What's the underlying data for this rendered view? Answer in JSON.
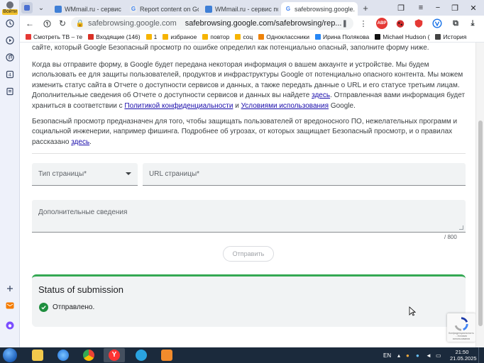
{
  "sidepanel": {
    "login_label": "Войти"
  },
  "tabs": [
    {
      "title": "",
      "icon": "yandex-icon"
    },
    {
      "title": "WMmail.ru - сервис по",
      "icon": "wmmail-icon"
    },
    {
      "title": "Report content on Goo",
      "icon": "google-icon"
    },
    {
      "title": "WMmail.ru - сервис по",
      "icon": "wmmail-icon"
    },
    {
      "title": "safebrowsing.google.",
      "icon": "google-icon"
    }
  ],
  "address": {
    "host": "safebrowsing.google.com",
    "url": "safebrowsing.google.com/safebrowsing/rep..."
  },
  "extensions": {
    "abp_label": "ABP"
  },
  "bookmarks": [
    {
      "label": "Смотреть ТВ – те",
      "color": "#e53935"
    },
    {
      "label": "Входящие (146)",
      "color": "#d93025"
    },
    {
      "label": "1",
      "color": "#f6b400"
    },
    {
      "label": "избраное",
      "color": "#f6b400"
    },
    {
      "label": "повтор",
      "color": "#f6b400"
    },
    {
      "label": "соц",
      "color": "#f6b400"
    },
    {
      "label": "Одноклассники",
      "color": "#ee8208"
    },
    {
      "label": "Ирина Полякова",
      "color": "#2787f5"
    },
    {
      "label": "Michael Hudson (",
      "color": "#111111"
    },
    {
      "label": "История",
      "color": "#444444"
    }
  ],
  "content": {
    "intro_tail": "сайте, который Google Безопасный просмотр по ошибке определил как потенциально опасный, заполните форму ниже.",
    "p2_a": "Когда вы отправите форму, в Google будет передана некоторая информация о вашем аккаунте и устройстве. Мы будем использовать ее для защиты пользователей, продуктов и инфраструктуры Google от потенциально опасного контента. Мы можем изменить статус сайта в Отчете о доступности сервисов и данных, а также передать данные о URL и его статусе третьим лицам. Дополнительные сведения об Отчете о доступности сервисов и данных вы найдете ",
    "p2_link1": "здесь",
    "p2_b": ". Отправленная вами информация будет храниться в соответствии с ",
    "p2_link2": "Политикой конфиденциальности",
    "p2_c": " и ",
    "p2_link3": "Условиями использования",
    "p2_d": " Google.",
    "p3_a": "Безопасный просмотр предназначен для того, чтобы защищать пользователей от вредоносного ПО, нежелательных программ и социальной инженерии, например фишинга. Подробнее об угрозах, от которых защищает Безопасный просмотр, и о правилах рассказано ",
    "p3_link": "здесь",
    "p3_b": "."
  },
  "form": {
    "page_type_label": "Тип страницы*",
    "url_label": "URL страницы*",
    "details_label": "Дополнительные сведения",
    "counter": "/ 800",
    "submit_label": "Отправить"
  },
  "status": {
    "title": "Status of submission",
    "message": "Отправлено.",
    "accent": "#34a853"
  },
  "recaptcha": {
    "text": "Конфиденциальность - Условия использования"
  },
  "taskbar": {
    "lang": "EN",
    "time": "21:50",
    "date": "21.05.2025"
  }
}
